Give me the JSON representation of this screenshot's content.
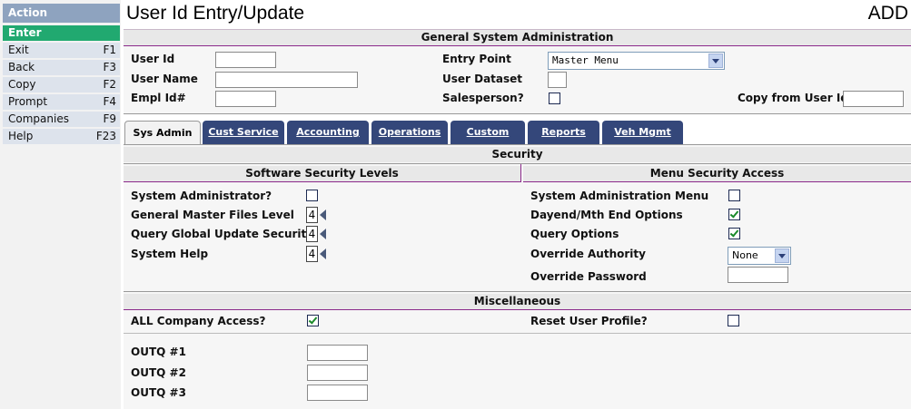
{
  "sidebar": {
    "header": "Action",
    "enter": "Enter",
    "items": [
      {
        "label": "Exit",
        "key": "F1"
      },
      {
        "label": "Back",
        "key": "F3"
      },
      {
        "label": "Copy",
        "key": "F2"
      },
      {
        "label": "Prompt",
        "key": "F4"
      },
      {
        "label": "Companies",
        "key": "F9"
      },
      {
        "label": "Help",
        "key": "F23"
      }
    ]
  },
  "header": {
    "title": "User Id Entry/Update",
    "mode": "ADD"
  },
  "general": {
    "section_title": "General System Administration",
    "user_id_label": "User Id",
    "user_id_value": "",
    "user_name_label": "User Name",
    "user_name_value": "",
    "empl_id_label": "Empl Id#",
    "empl_id_value": "",
    "entry_point_label": "Entry Point",
    "entry_point_value": "Master Menu",
    "user_dataset_label": "User Dataset",
    "user_dataset_value": "",
    "salesperson_label": "Salesperson?",
    "salesperson_checked": false,
    "copy_from_label": "Copy from User Id",
    "copy_from_value": ""
  },
  "tabs": [
    {
      "label": "Sys Admin"
    },
    {
      "label": "Cust Service"
    },
    {
      "label": "Accounting"
    },
    {
      "label": "Operations"
    },
    {
      "label": "Custom"
    },
    {
      "label": "Reports"
    },
    {
      "label": "Veh Mgmt"
    }
  ],
  "security": {
    "section_title": "Security",
    "software_title": "Software Security Levels",
    "menu_title": "Menu Security Access",
    "sys_admin_label": "System Administrator?",
    "sys_admin_checked": false,
    "gen_master_label": "General Master Files Level",
    "gen_master_value": "4",
    "query_global_label": "Query Global Update Security",
    "query_global_value": "4",
    "system_help_label": "System Help",
    "system_help_value": "4",
    "sys_admin_menu_label": "System Administration Menu",
    "sys_admin_menu_checked": false,
    "dayend_label": "Dayend/Mth End Options",
    "dayend_checked": true,
    "query_options_label": "Query Options",
    "query_options_checked": true,
    "override_authority_label": "Override Authority",
    "override_authority_value": "None",
    "override_password_label": "Override Password",
    "override_password_value": ""
  },
  "misc": {
    "section_title": "Miscellaneous",
    "all_company_label": "ALL Company Access?",
    "all_company_checked": true,
    "reset_profile_label": "Reset User Profile?",
    "reset_profile_checked": false,
    "outq1_label": "OUTQ #1",
    "outq1_value": "",
    "outq2_label": "OUTQ #2",
    "outq2_value": "",
    "outq3_label": "OUTQ #3",
    "outq3_value": ""
  },
  "colors": {
    "enter_green": "#21a970",
    "action_header": "#8ea3bf",
    "tab_navy": "#34477a",
    "check_green": "#1a8a2a",
    "divider_purple": "#8b2a8b"
  }
}
